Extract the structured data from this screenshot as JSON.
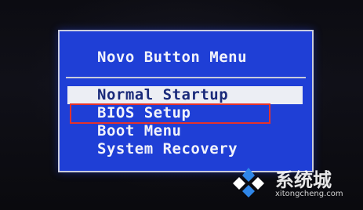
{
  "menu": {
    "title": "Novo Button Menu",
    "items": [
      {
        "label": "Normal Startup",
        "selected": true
      },
      {
        "label": "BIOS Setup",
        "selected": false,
        "annotated": true
      },
      {
        "label": "Boot Menu",
        "selected": false
      },
      {
        "label": "System Recovery",
        "selected": false
      }
    ]
  },
  "annotation": {
    "color": "#e5322b"
  },
  "watermark": {
    "text": "系统城",
    "url": "xitongcheng.com",
    "logo_icon": "diamond-logo-icon"
  },
  "colors": {
    "panel": "#1f3fd6",
    "selected_row": "#eceef4",
    "text": "#f2f3fb"
  }
}
